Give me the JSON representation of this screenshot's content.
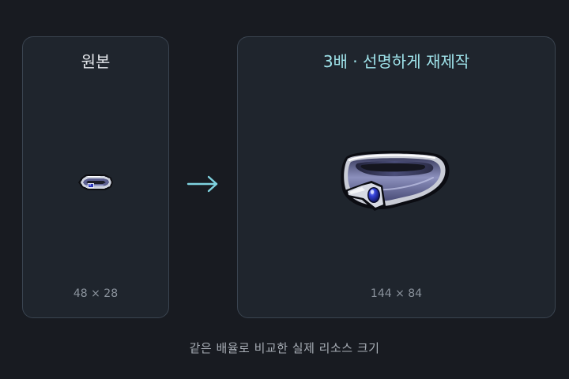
{
  "original": {
    "title": "원본",
    "size_label": "48 × 28",
    "image_icon": "ring-icon"
  },
  "upscaled": {
    "title": "3배 · 선명하게 재제작",
    "size_label": "144 × 84",
    "image_icon": "ring-icon"
  },
  "arrow_icon": "arrow-right-icon",
  "caption": "같은 배율로 비교한 실제 리소스 크기",
  "colors": {
    "background": "#181b21",
    "panel": "#1f252d",
    "panel_border": "#3a4450",
    "accent": "#9fe3ea",
    "gem": "#3b48c8",
    "band": "#6e739c"
  }
}
